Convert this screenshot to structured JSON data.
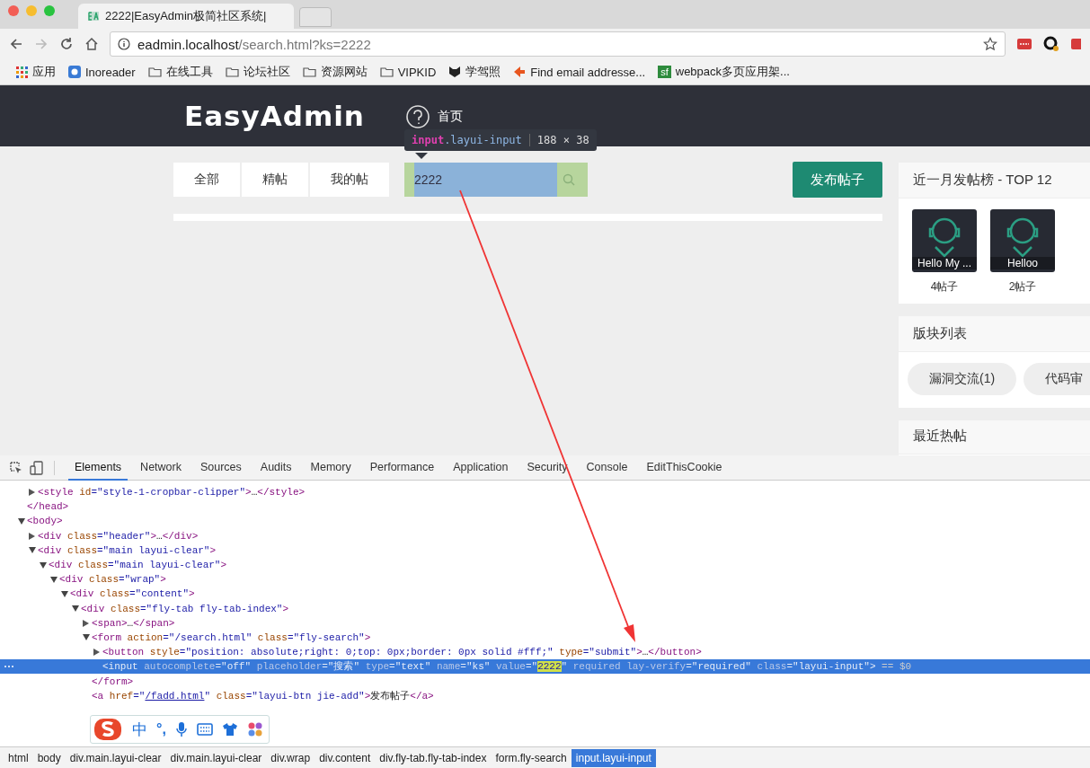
{
  "browser": {
    "tab_title": "2222|EasyAdmin极简社区系统|",
    "url_host": "eadmin.localhost",
    "url_path": "/search.html?ks=2222",
    "bookmarks": [
      {
        "kind": "apps",
        "label": "应用"
      },
      {
        "kind": "site",
        "label": "Inoreader"
      },
      {
        "kind": "folder",
        "label": "在线工具"
      },
      {
        "kind": "folder",
        "label": "论坛社区"
      },
      {
        "kind": "folder",
        "label": "资源网站"
      },
      {
        "kind": "folder",
        "label": "VIPKID"
      },
      {
        "kind": "cat",
        "label": "学驾照"
      },
      {
        "kind": "flag",
        "label": "Find email addresse..."
      },
      {
        "kind": "badge",
        "badge": "sf",
        "label": "webpack多页应用架..."
      }
    ]
  },
  "page": {
    "logo": "EasyAdmin",
    "nav": "首页",
    "inspect_tooltip": {
      "tag": "input",
      "class_name": ".layui-input",
      "size": "188 × 38"
    },
    "filter_tabs": [
      "全部",
      "精帖",
      "我的帖"
    ],
    "search_value": "2222",
    "publish_button": "发布帖子",
    "sidebar": [
      {
        "kind": "users",
        "title": "近一月发帖榜 - TOP 12",
        "users": [
          {
            "name": "Hello My ...",
            "count": "4帖子"
          },
          {
            "name": "Helloo",
            "count": "2帖子"
          }
        ]
      },
      {
        "kind": "tags",
        "title": "版块列表",
        "tags": [
          "漏洞交流(1)",
          "代码审"
        ]
      },
      {
        "kind": "cut",
        "title": "最近热帖"
      }
    ]
  },
  "devtools": {
    "tabs": [
      {
        "label": "Elements",
        "selected": true
      },
      {
        "label": "Network",
        "selected": false
      },
      {
        "label": "Sources",
        "selected": false
      },
      {
        "label": "Audits",
        "selected": false
      },
      {
        "label": "Memory",
        "selected": false
      },
      {
        "label": "Performance",
        "selected": false
      },
      {
        "label": "Application",
        "selected": false
      },
      {
        "label": "Security",
        "selected": false
      },
      {
        "label": "Console",
        "selected": false
      },
      {
        "label": "EditThisCookie",
        "selected": false
      }
    ],
    "dom": [
      {
        "children": [
          {
            "expanded": false,
            "selected": false,
            "parts": [
              {
                "kind": "tag",
                "text": "<style"
              },
              {
                "kind": "attr",
                "text": " id"
              },
              {
                "kind": "value",
                "text": "=\"style-1-cropbar-clipper\""
              },
              {
                "kind": "tag",
                "text": ">"
              },
              {
                "kind": "text",
                "text": "…"
              },
              {
                "kind": "tag",
                "text": "</style>"
              }
            ]
          }
        ],
        "close": [
          {
            "kind": "tag",
            "text": "</head>"
          }
        ]
      },
      {
        "expanded": true,
        "selected": false,
        "parts": [
          {
            "kind": "tag",
            "text": "<body>"
          }
        ],
        "children": [
          {
            "expanded": false,
            "selected": false,
            "parts": [
              {
                "kind": "tag",
                "text": "<div"
              },
              {
                "kind": "attr",
                "text": " class"
              },
              {
                "kind": "value",
                "text": "=\"header\""
              },
              {
                "kind": "tag",
                "text": ">"
              },
              {
                "kind": "text",
                "text": "…"
              },
              {
                "kind": "tag",
                "text": "</div>"
              }
            ]
          },
          {
            "expanded": true,
            "selected": false,
            "parts": [
              {
                "kind": "tag",
                "text": "<div"
              },
              {
                "kind": "attr",
                "text": " class"
              },
              {
                "kind": "value",
                "text": "=\"main layui-clear\""
              },
              {
                "kind": "tag",
                "text": ">"
              }
            ],
            "children": [
              {
                "expanded": true,
                "selected": false,
                "parts": [
                  {
                    "kind": "tag",
                    "text": "<div"
                  },
                  {
                    "kind": "attr",
                    "text": " class"
                  },
                  {
                    "kind": "value",
                    "text": "=\"main layui-clear\""
                  },
                  {
                    "kind": "tag",
                    "text": ">"
                  }
                ],
                "children": [
                  {
                    "expanded": true,
                    "selected": false,
                    "parts": [
                      {
                        "kind": "tag",
                        "text": "<div"
                      },
                      {
                        "kind": "attr",
                        "text": " class"
                      },
                      {
                        "kind": "value",
                        "text": "=\"wrap\""
                      },
                      {
                        "kind": "tag",
                        "text": ">"
                      }
                    ],
                    "children": [
                      {
                        "expanded": true,
                        "selected": false,
                        "parts": [
                          {
                            "kind": "tag",
                            "text": "<div"
                          },
                          {
                            "kind": "attr",
                            "text": " class"
                          },
                          {
                            "kind": "value",
                            "text": "=\"content\""
                          },
                          {
                            "kind": "tag",
                            "text": ">"
                          }
                        ],
                        "children": [
                          {
                            "expanded": true,
                            "selected": false,
                            "parts": [
                              {
                                "kind": "tag",
                                "text": "<div"
                              },
                              {
                                "kind": "attr",
                                "text": " class"
                              },
                              {
                                "kind": "value",
                                "text": "=\"fly-tab fly-tab-index\""
                              },
                              {
                                "kind": "tag",
                                "text": ">"
                              }
                            ],
                            "children": [
                              {
                                "expanded": false,
                                "selected": false,
                                "parts": [
                                  {
                                    "kind": "tag",
                                    "text": "<span>"
                                  },
                                  {
                                    "kind": "text",
                                    "text": "…"
                                  },
                                  {
                                    "kind": "tag",
                                    "text": "</span>"
                                  }
                                ]
                              },
                              {
                                "expanded": true,
                                "selected": false,
                                "parts": [
                                  {
                                    "kind": "tag",
                                    "text": "<form"
                                  },
                                  {
                                    "kind": "attr",
                                    "text": " action"
                                  },
                                  {
                                    "kind": "value",
                                    "text": "=\"/search.html\""
                                  },
                                  {
                                    "kind": "attr",
                                    "text": " class"
                                  },
                                  {
                                    "kind": "value",
                                    "text": "=\"fly-search\""
                                  },
                                  {
                                    "kind": "tag",
                                    "text": ">"
                                  }
                                ],
                                "children": [
                                  {
                                    "expanded": false,
                                    "selected": false,
                                    "parts": [
                                      {
                                        "kind": "tag",
                                        "text": "<button"
                                      },
                                      {
                                        "kind": "attr",
                                        "text": " style"
                                      },
                                      {
                                        "kind": "value",
                                        "text": "=\"position: absolute;right: 0;top: 0px;border: 0px solid #fff;\""
                                      },
                                      {
                                        "kind": "attr",
                                        "text": " type"
                                      },
                                      {
                                        "kind": "value",
                                        "text": "=\"submit\""
                                      },
                                      {
                                        "kind": "tag",
                                        "text": ">"
                                      },
                                      {
                                        "kind": "text",
                                        "text": "…"
                                      },
                                      {
                                        "kind": "tag",
                                        "text": "</button>"
                                      }
                                    ]
                                  },
                                  {
                                    "selected": true,
                                    "parts": [
                                      {
                                        "kind": "tag",
                                        "text": "<input"
                                      },
                                      {
                                        "kind": "attr",
                                        "text": " autocomplete"
                                      },
                                      {
                                        "kind": "value",
                                        "text": "=\"off\""
                                      },
                                      {
                                        "kind": "attr",
                                        "text": " placeholder"
                                      },
                                      {
                                        "kind": "value",
                                        "text": "=\"搜索\""
                                      },
                                      {
                                        "kind": "attr",
                                        "text": " type"
                                      },
                                      {
                                        "kind": "value",
                                        "text": "=\"text\""
                                      },
                                      {
                                        "kind": "attr",
                                        "text": " name"
                                      },
                                      {
                                        "kind": "value",
                                        "text": "=\"ks\""
                                      },
                                      {
                                        "kind": "attr",
                                        "text": " value"
                                      },
                                      {
                                        "kind": "value",
                                        "text": "=\""
                                      },
                                      {
                                        "kind": "match",
                                        "text": "2222"
                                      },
                                      {
                                        "kind": "value",
                                        "text": "\""
                                      },
                                      {
                                        "kind": "attr",
                                        "text": " required"
                                      },
                                      {
                                        "kind": "attr",
                                        "text": " lay-verify"
                                      },
                                      {
                                        "kind": "value",
                                        "text": "=\"required\""
                                      },
                                      {
                                        "kind": "attr",
                                        "text": " class"
                                      },
                                      {
                                        "kind": "value",
                                        "text": "=\"layui-input\""
                                      },
                                      {
                                        "kind": "tag",
                                        "text": ">"
                                      },
                                      {
                                        "kind": "ref",
                                        "text": " == $0"
                                      }
                                    ]
                                  }
                                ],
                                "close": [
                                  {
                                    "kind": "tag",
                                    "text": "</form>"
                                  }
                                ]
                              },
                              {
                                "selected": false,
                                "parts": [
                                  {
                                    "kind": "tag",
                                    "text": "<a"
                                  },
                                  {
                                    "kind": "attr",
                                    "text": " href"
                                  },
                                  {
                                    "kind": "value",
                                    "text": "=\""
                                  },
                                  {
                                    "kind": "link",
                                    "text": "/fadd.html"
                                  },
                                  {
                                    "kind": "value",
                                    "text": "\""
                                  },
                                  {
                                    "kind": "attr",
                                    "text": " class"
                                  },
                                  {
                                    "kind": "value",
                                    "text": "=\"layui-btn jie-add\""
                                  },
                                  {
                                    "kind": "tag",
                                    "text": ">"
                                  },
                                  {
                                    "kind": "text",
                                    "text": "发布帖子"
                                  },
                                  {
                                    "kind": "tag",
                                    "text": "</a>"
                                  }
                                ]
                              }
                            ]
                          }
                        ]
                      }
                    ]
                  }
                ]
              }
            ]
          }
        ]
      }
    ],
    "ime": {
      "mode": "中",
      "punct": "°,"
    },
    "breadcrumbs": [
      {
        "label": "html",
        "selected": false
      },
      {
        "label": "body",
        "selected": false
      },
      {
        "label": "div.main.layui-clear",
        "selected": false
      },
      {
        "label": "div.main.layui-clear",
        "selected": false
      },
      {
        "label": "div.wrap",
        "selected": false
      },
      {
        "label": "div.content",
        "selected": false
      },
      {
        "label": "div.fly-tab.fly-tab-index",
        "selected": false
      },
      {
        "label": "form.fly-search",
        "selected": false
      },
      {
        "label": "input.layui-input",
        "selected": true
      }
    ]
  }
}
